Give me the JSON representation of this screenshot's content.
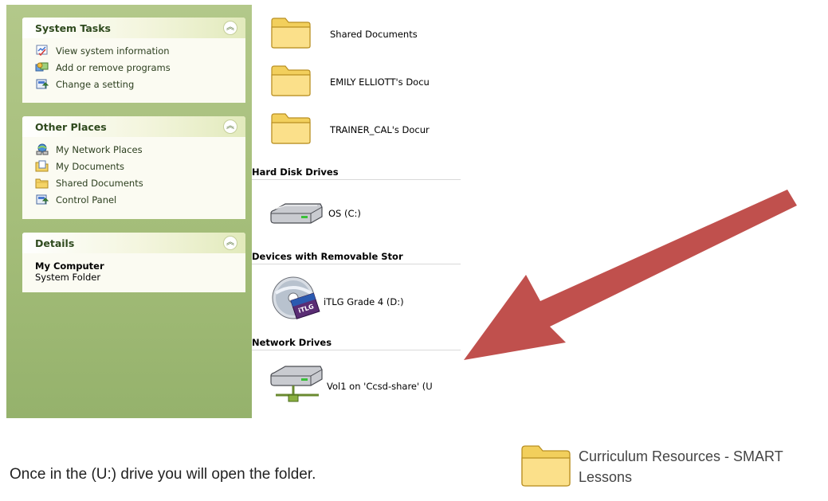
{
  "taskpane": {
    "system_tasks": {
      "title": "System Tasks",
      "items": [
        {
          "label": "View system information",
          "icon": "system-info-icon"
        },
        {
          "label": "Add or remove programs",
          "icon": "add-remove-programs-icon"
        },
        {
          "label": "Change a setting",
          "icon": "control-panel-icon"
        }
      ]
    },
    "other_places": {
      "title": "Other Places",
      "items": [
        {
          "label": "My Network Places",
          "icon": "network-places-icon"
        },
        {
          "label": "My Documents",
          "icon": "my-documents-icon"
        },
        {
          "label": "Shared Documents",
          "icon": "folder-icon"
        },
        {
          "label": "Control Panel",
          "icon": "control-panel-icon"
        }
      ]
    },
    "details": {
      "title": "Details",
      "name": "My Computer",
      "type": "System Folder"
    }
  },
  "content": {
    "folders": [
      {
        "label": "Shared Documents",
        "icon": "folder-icon"
      },
      {
        "label": "EMILY ELLIOTT's Docu",
        "icon": "folder-icon"
      },
      {
        "label": "TRAINER_CAL's Docur",
        "icon": "folder-icon"
      }
    ],
    "hard_disk": {
      "header": "Hard Disk Drives",
      "items": [
        {
          "label": "OS (C:)",
          "icon": "hard-drive-icon"
        }
      ]
    },
    "removable": {
      "header": "Devices with Removable Stor",
      "items": [
        {
          "label": "iTLG Grade 4 (D:)",
          "icon": "cd-drive-icon"
        }
      ]
    },
    "network": {
      "header": "Network Drives",
      "items": [
        {
          "label": "Vol1 on 'Ccsd-share' (U",
          "icon": "network-drive-icon"
        }
      ]
    }
  },
  "annotation": {
    "arrow_color": "#c0504d",
    "caption": "Once in the (U:) drive you will open the  folder.",
    "target_folder": "Curriculum Resources - SMART Lessons"
  },
  "colors": {
    "pane_green": "#a4bd79",
    "folder_yellow": "#f7d96a"
  }
}
